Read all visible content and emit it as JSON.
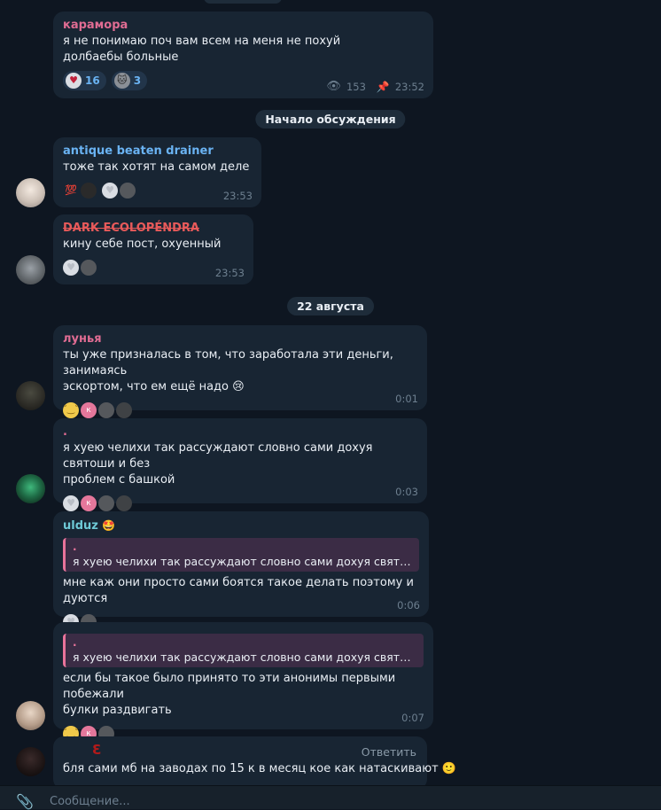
{
  "colors": {
    "background": "#0e1621",
    "bubble": "#182533",
    "accent": "#6ab3f3",
    "meta": "#6d7f8f",
    "quote_bg": "#3b2c45",
    "quote_bar": "#e8739a"
  },
  "messages": {
    "m1": {
      "author": "карамора",
      "text": "я не понимаю поч вам всем на меня не похуй долбаебы больные",
      "reactions": [
        {
          "emoji": "heart-eyes-sticker",
          "count": "16"
        },
        {
          "emoji": "cat-sticker",
          "count": "3"
        }
      ],
      "views": "153",
      "time": "23:52"
    },
    "date1": "Начало обсуждения",
    "m2": {
      "author": "antique beaten drainer",
      "text": "тоже так хотят на самом деле",
      "time": "23:53",
      "reactions": [
        "💯",
        "sticker",
        "sticker",
        "sticker"
      ]
    },
    "m3": {
      "author": "DARK ЕCOLOPÉNDRA",
      "text": "кину себе пост, охуенный",
      "time": "23:53"
    },
    "date2": "22 августа",
    "m4": {
      "author": "лунья",
      "text_line1": "ты уже призналась в том, что заработала эти деньги, занимаясь",
      "text_line2": "эскортом, что ем ещё надо",
      "emoji": "😢",
      "time": "0:01",
      "react_k": "к"
    },
    "m5": {
      "author": ".",
      "text_line1": "я хуею челихи так рассуждают словно сами дохуя святоши и без",
      "text_line2": "проблем с башкой",
      "time": "0:03",
      "react_k": "к"
    },
    "m6": {
      "author": "ulduz",
      "author_emoji": "🤩",
      "quote_author": ".",
      "quote_text": "я хуею челихи так рассуждают словно сами дохуя святоши ...",
      "text": "мне каж они просто сами боятся такое делать поэтому и дуются",
      "time": "0:06"
    },
    "m7": {
      "quote_author": ".",
      "quote_text": "я хуею челихи так рассуждают словно сами дохуя святоши и ...",
      "text_line1": "если бы такое было принято то эти анонимы первыми побежали",
      "text_line2": "булки раздвигать",
      "time": "0:07",
      "react_k": "к"
    },
    "m8": {
      "reply_label": "Ответить",
      "text": "бля сами мб  на заводах по 15 к в месяц кое как натаскивают",
      "emoji": "🙂"
    }
  },
  "composer": {
    "placeholder": "Сообщение..."
  }
}
